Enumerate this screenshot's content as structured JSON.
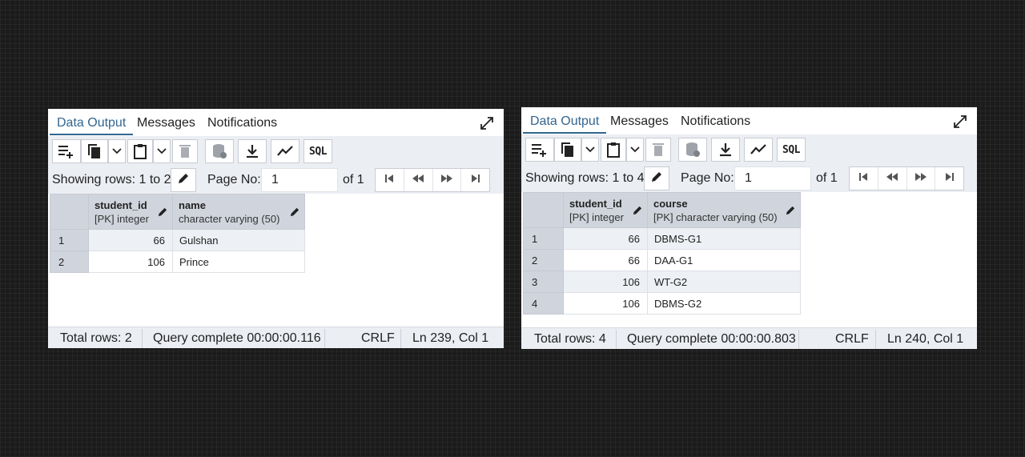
{
  "tabs": [
    "Data Output",
    "Messages",
    "Notifications"
  ],
  "toolbar": {
    "sql_label": "SQL",
    "showing_label": "Showing rows:",
    "page_label": "Page No:",
    "of_label": "of"
  },
  "panels": [
    {
      "showing_range": "1 to 2",
      "page_no": "1",
      "page_total": "1",
      "columns": [
        {
          "name": "student_id",
          "type": "[PK] integer"
        },
        {
          "name": "name",
          "type": "character varying (50)"
        }
      ],
      "rows": [
        {
          "num": "1",
          "c1": "66",
          "c2": "Gulshan"
        },
        {
          "num": "2",
          "c1": "106",
          "c2": "Prince"
        }
      ],
      "status": {
        "total_rows": "Total rows: 2",
        "query": "Query complete 00:00:00.116",
        "eol": "CRLF",
        "position": "Ln 239, Col 1"
      }
    },
    {
      "showing_range": "1 to 4",
      "page_no": "1",
      "page_total": "1",
      "columns": [
        {
          "name": "student_id",
          "type": "[PK] integer"
        },
        {
          "name": "course",
          "type": "[PK] character varying (50)"
        }
      ],
      "rows": [
        {
          "num": "1",
          "c1": "66",
          "c2": "DBMS-G1"
        },
        {
          "num": "2",
          "c1": "66",
          "c2": "DAA-G1"
        },
        {
          "num": "3",
          "c1": "106",
          "c2": "WT-G2"
        },
        {
          "num": "4",
          "c1": "106",
          "c2": "DBMS-G2"
        }
      ],
      "status": {
        "total_rows": "Total rows: 4",
        "query": "Query complete 00:00:00.803",
        "eol": "CRLF",
        "position": "Ln 240, Col 1"
      }
    }
  ],
  "colors": {
    "accent": "#326690",
    "toolbar_bg": "#ebeef3",
    "header_bg": "#d0d5dd",
    "row_alt_bg": "#edf0f4",
    "background": "#1b1b1b"
  },
  "icons": [
    "add-row-icon",
    "copy-icon",
    "chevron-down-icon",
    "paste-icon",
    "delete-icon",
    "save-data-icon",
    "download-icon",
    "graph-icon",
    "edit-icon",
    "first-page-icon",
    "previous-page-icon",
    "next-page-icon",
    "last-page-icon",
    "expand-icon"
  ]
}
